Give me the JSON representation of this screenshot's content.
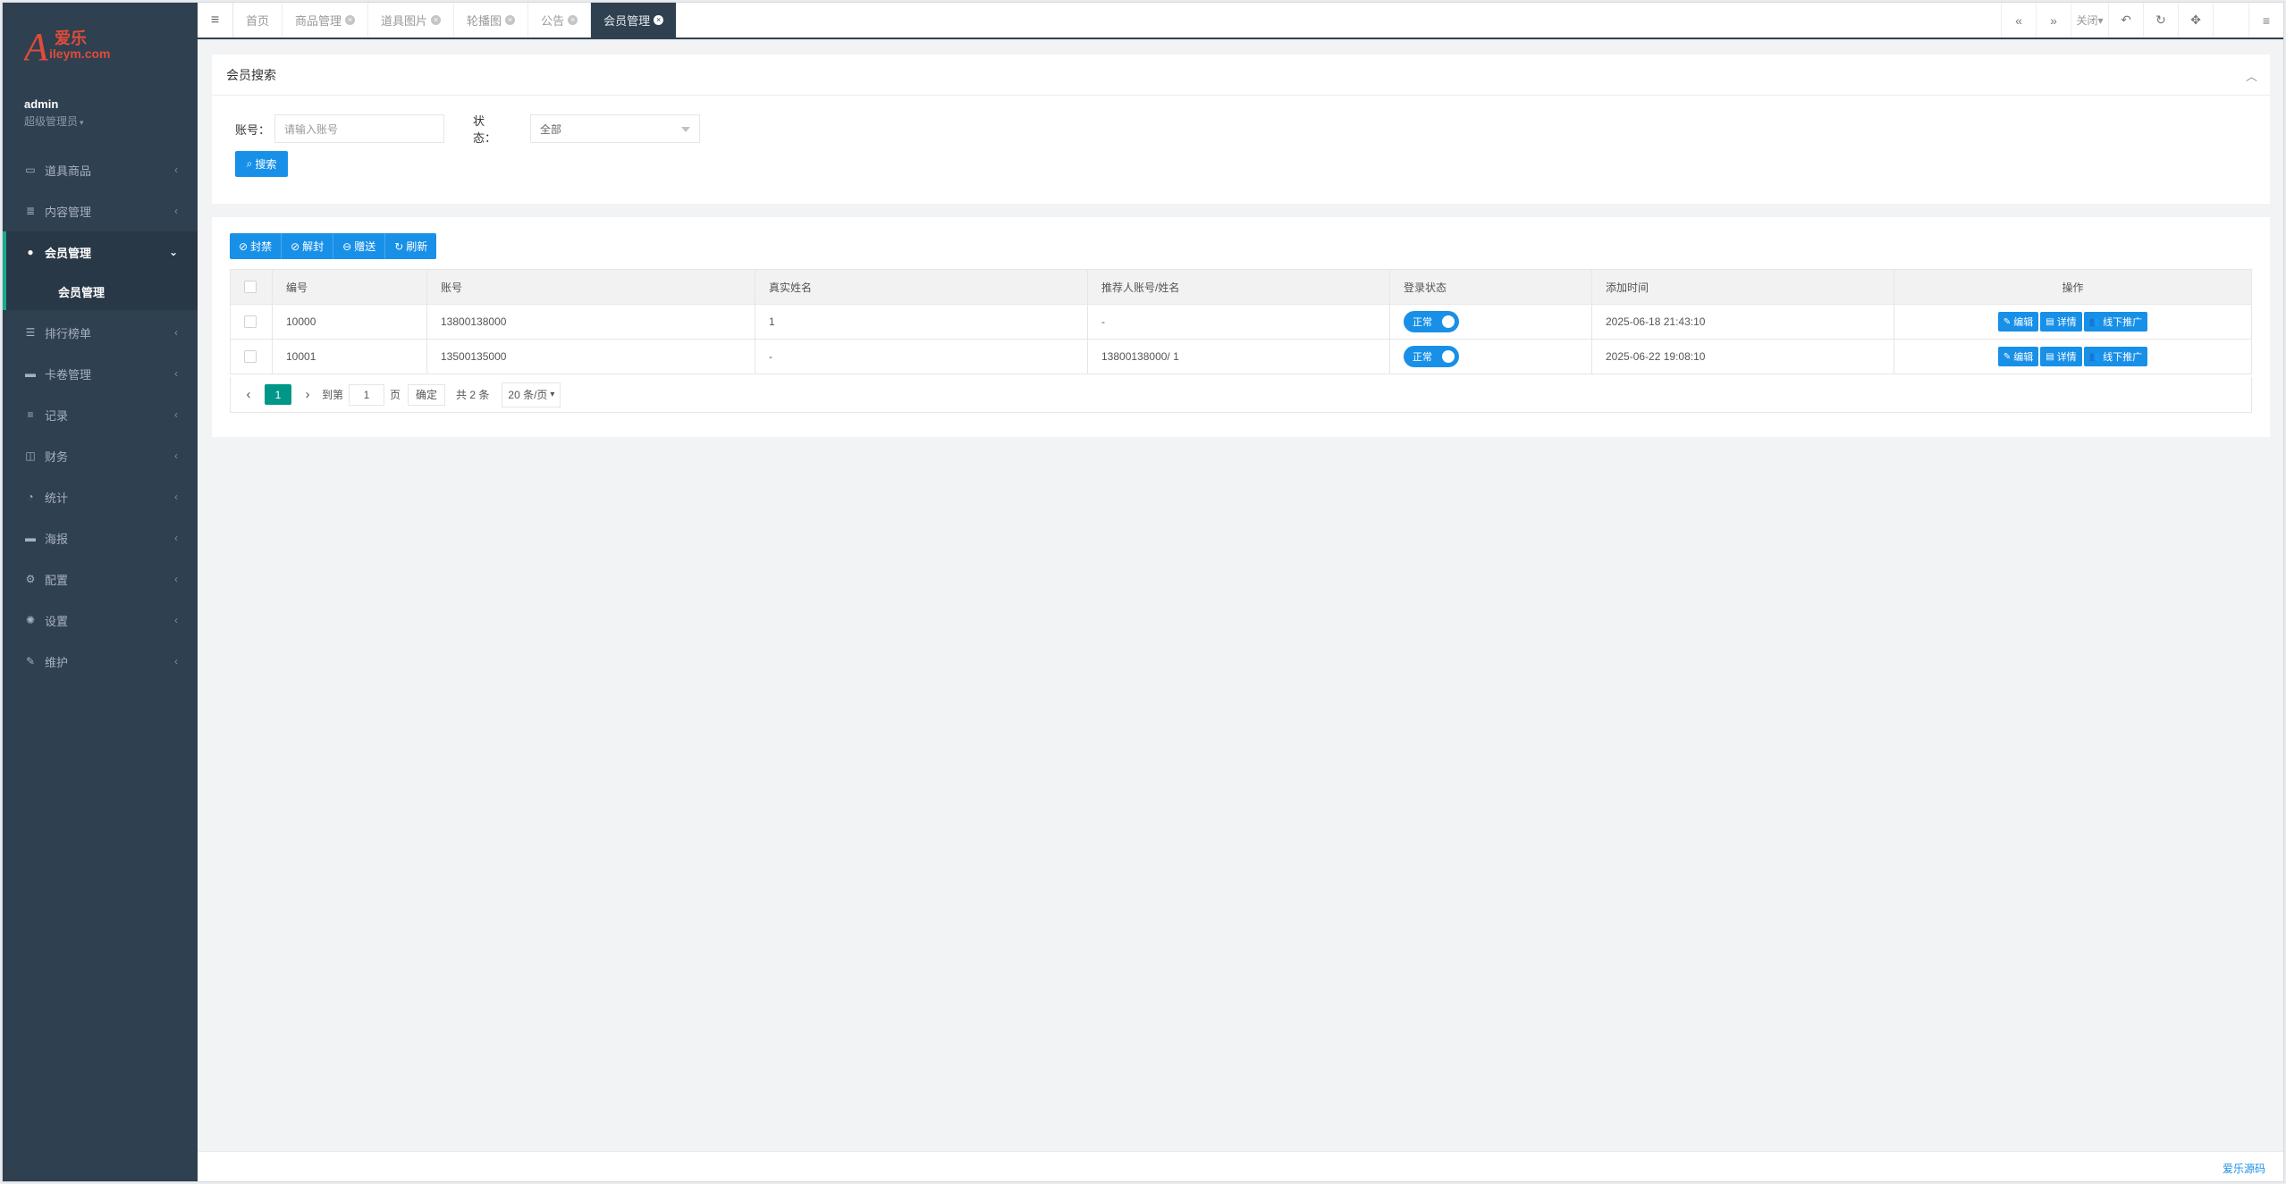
{
  "sidebar": {
    "logo_text": "爱乐",
    "logo_sub": "ileym.com",
    "user": {
      "name": "admin",
      "role": "超级管理员"
    },
    "items": [
      {
        "label": "道具商品",
        "icon": "laptop-icon"
      },
      {
        "label": "内容管理",
        "icon": "database-icon"
      },
      {
        "label": "会员管理",
        "icon": "user-icon",
        "active": true,
        "children": [
          {
            "label": "会员管理"
          }
        ]
      },
      {
        "label": "排行榜单",
        "icon": "list-icon"
      },
      {
        "label": "卡卷管理",
        "icon": "card-icon"
      },
      {
        "label": "记录",
        "icon": "align-icon"
      },
      {
        "label": "财务",
        "icon": "money-icon"
      },
      {
        "label": "统计",
        "icon": "chart-icon"
      },
      {
        "label": "海报",
        "icon": "poster-icon"
      },
      {
        "label": "配置",
        "icon": "cogs-icon"
      },
      {
        "label": "设置",
        "icon": "gear-icon"
      },
      {
        "label": "维护",
        "icon": "wrench-icon"
      }
    ]
  },
  "topbar": {
    "tabs": [
      {
        "label": "首页",
        "closable": false
      },
      {
        "label": "商品管理",
        "closable": true
      },
      {
        "label": "道具图片",
        "closable": true
      },
      {
        "label": "轮播图",
        "closable": true
      },
      {
        "label": "公告",
        "closable": true
      },
      {
        "label": "会员管理",
        "closable": true,
        "active": true
      }
    ],
    "close_label": "关闭"
  },
  "search": {
    "title": "会员搜索",
    "account_label": "账号：",
    "account_placeholder": "请输入账号",
    "status_label": "状　　态：",
    "status_value": "全部",
    "search_button": "搜索"
  },
  "toolbar": {
    "ban": "封禁",
    "unban": "解封",
    "gift": "赠送",
    "refresh": "刷新"
  },
  "table": {
    "columns": [
      "编号",
      "账号",
      "真实姓名",
      "推荐人账号/姓名",
      "登录状态",
      "添加时间",
      "操作"
    ],
    "rows": [
      {
        "id": "10000",
        "account": "13800138000",
        "real_name": "1",
        "referrer": "-",
        "status": "正常",
        "created": "2025-06-18 21:43:10"
      },
      {
        "id": "10001",
        "account": "13500135000",
        "real_name": "-",
        "referrer": "13800138000/ 1",
        "status": "正常",
        "created": "2025-06-22 19:08:10"
      }
    ],
    "actions": {
      "edit": "编辑",
      "detail": "详情",
      "offline": "线下推广"
    }
  },
  "pager": {
    "current": "1",
    "goto_label": "到第",
    "page_value": "1",
    "page_unit": "页",
    "confirm": "确定",
    "total": "共 2 条",
    "page_size": "20 条/页"
  },
  "footer": {
    "link": "爱乐源码"
  },
  "colors": {
    "sidebar": "#2f4050",
    "primary": "#1890e8",
    "page_active": "#009688",
    "accent": "#19aa8d"
  }
}
